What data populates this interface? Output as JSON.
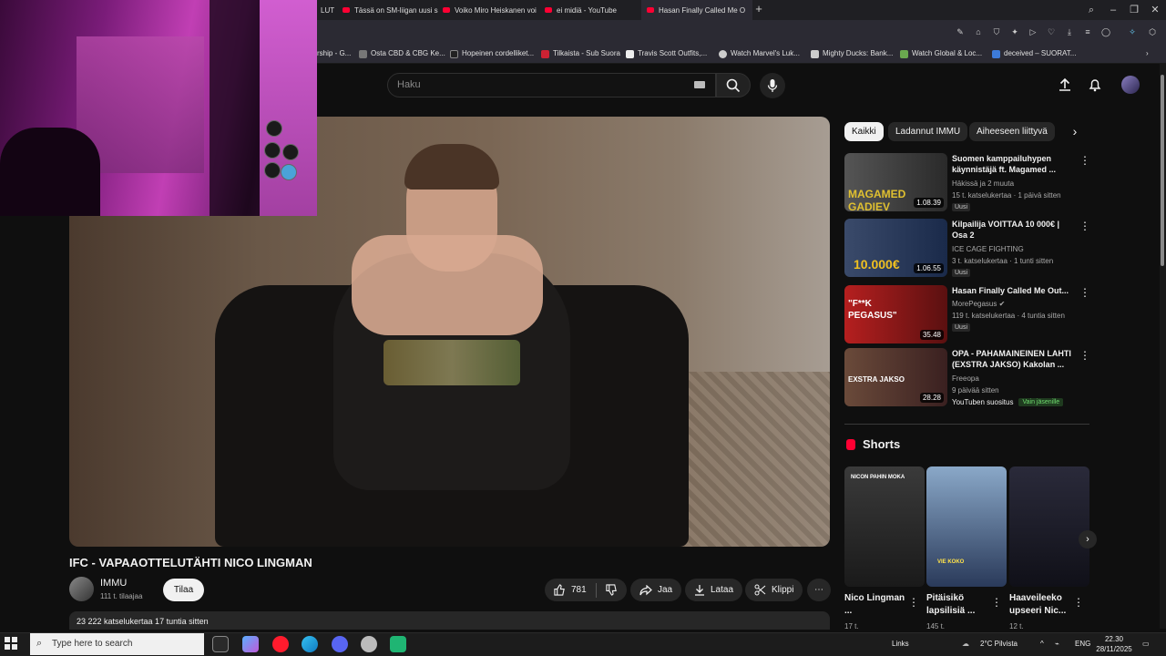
{
  "browser": {
    "tabs": [
      {
        "label": "LUT"
      },
      {
        "label": "Tässä on SM-liigan uusi s"
      },
      {
        "label": "Voiko Miro Heiskanen voi"
      },
      {
        "label": "ei midiä - YouTube"
      },
      {
        "label": "Hasan Finally Called Me O"
      }
    ],
    "new_tab": "+",
    "bookmarks": [
      {
        "label": "rship - G...",
        "color": "#4a4a4a"
      },
      {
        "label": "Osta CBD & CBG Ke...",
        "color": "#777777"
      },
      {
        "label": "Hopeinen cordelliket...",
        "color": "#222222"
      },
      {
        "label": "Tilkaista - Sub Suora",
        "color": "#cc2233"
      },
      {
        "label": "Travis Scott Outfits,...",
        "color": "#eeeeee"
      },
      {
        "label": "Watch Marvel's Luk...",
        "color": "#cccccc"
      },
      {
        "label": "Mighty Ducks: Bank...",
        "color": "#cccccc"
      },
      {
        "label": "Watch Global & Loc...",
        "color": "#6aa84f"
      },
      {
        "label": "deceived – SUORAT...",
        "color": "#3d7bd9"
      }
    ]
  },
  "youtube": {
    "search_placeholder": "Haku",
    "video": {
      "title": "IFC - VAPAAOTTELUTÄHTI NICO LINGMAN",
      "channel": "IMMU",
      "subscribers": "111 t. tilaajaa",
      "subscribe_label": "Tilaa",
      "likes": "781",
      "share_label": "Jaa",
      "download_label": "Lataa",
      "clip_label": "Klippi",
      "more_label": "⋯",
      "views_time": "23 222 katselukertaa  17 tuntia sitten"
    },
    "chips": [
      {
        "label": "Kaikki",
        "active": true
      },
      {
        "label": "Ladannut IMMU",
        "active": false
      },
      {
        "label": "Aiheeseen liittyvä",
        "active": false
      }
    ],
    "recommendations": [
      {
        "title": "Suomen kamppailuhypen käynnistäjä ft. Magamed ...",
        "channel": "Häkissä ja 2 muuta",
        "meta": "15 t. katselukertaa · 1 päivä sitten",
        "badge": "Uusi",
        "duration": "1.08.39",
        "thumb_colors": [
          "#555555",
          "#2a2a2a",
          "#e0c030"
        ],
        "thumb_text": "MAGAMED GADIEV"
      },
      {
        "title": "Kilpailija VOITTAA 10 000€ | Osa 2",
        "channel": "ICE CAGE FIGHTING",
        "meta": "3 t. katselukertaa · 1 tunti sitten",
        "badge": "Uusi",
        "duration": "1.06.55",
        "thumb_colors": [
          "#3a4a6a",
          "#1a2a4a",
          "#f0c020"
        ],
        "thumb_text": "10.000€"
      },
      {
        "title": "Hasan Finally Called Me Out...",
        "channel": "MorePegasus",
        "meta": "119 t. katselukertaa · 4 tuntia sitten",
        "badge": "Uusi",
        "duration": "35.48",
        "thumb_colors": [
          "#b51f1f",
          "#5a1010",
          "#ffffff"
        ],
        "thumb_text": "\"F**K PEGASUS\""
      },
      {
        "title": "OPA - PAHAMAINEINEN LAHTI (EXSTRA JAKSO) Kakolan ...",
        "channel": "Freeopa",
        "meta": "9 päivää sitten",
        "badge_recommend": "YouTuben suositus",
        "member": "Vain jäsenille",
        "duration": "28.28",
        "thumb_colors": [
          "#6a4a3a",
          "#3a2020",
          "#ffffff"
        ],
        "thumb_text": "EXSTRA JAKSO"
      }
    ],
    "shorts_title": "Shorts",
    "shorts": [
      {
        "title": "Nico Lingman ...",
        "views": "17 t.",
        "label": "NICON PAHIN MOKA",
        "colors": [
          "#3a3a3a",
          "#1a1a1a"
        ]
      },
      {
        "title": "Pitäisikö lapsilisiä ...",
        "views": "145 t.",
        "label": "VIE KOKO",
        "colors": [
          "#8aa8c8",
          "#2a3a5a"
        ]
      },
      {
        "title": "Haaveileeko upseeri Nic...",
        "views": "12 t.",
        "label": "",
        "colors": [
          "#2a2a3a",
          "#101018"
        ]
      }
    ]
  },
  "taskbar": {
    "search_placeholder": "Type here to search",
    "links": "Links",
    "weather": "2°C  Pilvista",
    "lang": "ENG",
    "time": "22.30",
    "date": "28/11/2025"
  }
}
